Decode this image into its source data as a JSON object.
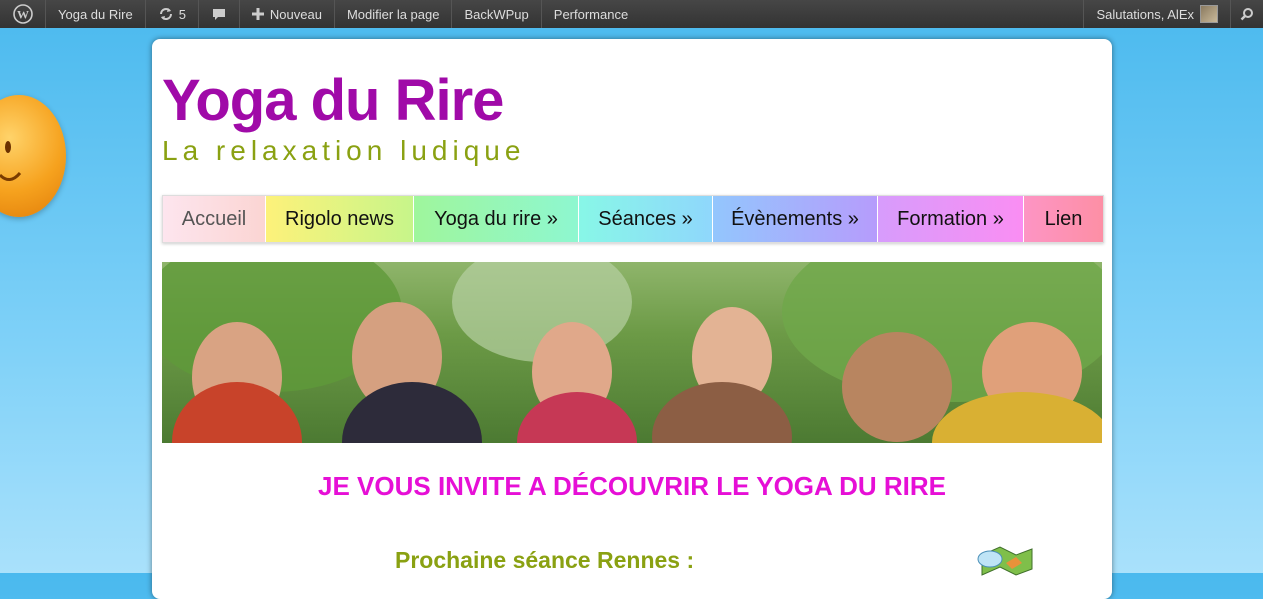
{
  "adminbar": {
    "site_name": "Yoga du Rire",
    "updates_count": "5",
    "new_label": "Nouveau",
    "edit_label": "Modifier la page",
    "backup_label": "BackWPup",
    "performance_label": "Performance",
    "greeting": "Salutations, AlEx",
    "icons": [
      "wordpress-icon",
      "updates-icon",
      "comments-icon",
      "plus-icon",
      "search-icon"
    ]
  },
  "site": {
    "title": "Yoga du Rire",
    "tagline": "La relaxation ludique"
  },
  "nav": {
    "items": [
      {
        "label": "Accueil"
      },
      {
        "label": "Rigolo news"
      },
      {
        "label": "Yoga du rire »"
      },
      {
        "label": "Séances »"
      },
      {
        "label": "Évènements »"
      },
      {
        "label": "Formation »"
      },
      {
        "label": "Lien"
      }
    ]
  },
  "content": {
    "headline": "JE VOUS INVITE A DÉCOUVRIR LE YOGA DU RIRE",
    "next_session": "Prochaine séance  Rennes  :"
  },
  "colors": {
    "title": "#a00aa8",
    "tagline": "#8aa112",
    "headline": "#e60fd6",
    "background": "#4ab9ee"
  }
}
